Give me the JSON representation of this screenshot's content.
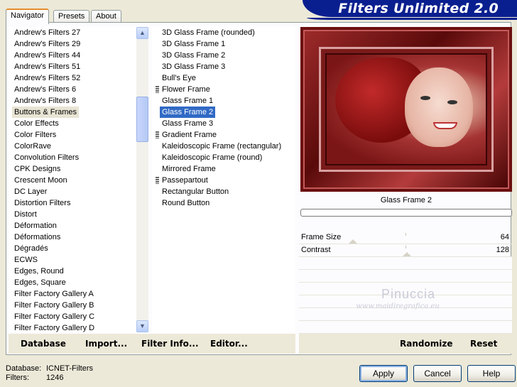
{
  "title": "Filters Unlimited 2.0",
  "tabs": [
    {
      "label": "Navigator",
      "active": true
    },
    {
      "label": "Presets",
      "active": false
    },
    {
      "label": "About",
      "active": false
    }
  ],
  "categories": {
    "selected": "Buttons & Frames",
    "items": [
      "Andrew's Filters 27",
      "Andrew's Filters 29",
      "Andrew's Filters 44",
      "Andrew's Filters 51",
      "Andrew's Filters 52",
      "Andrew's Filters 6",
      "Andrew's Filters 8",
      "Buttons & Frames",
      "Color Effects",
      "Color Filters",
      "ColorRave",
      "Convolution Filters",
      "CPK Designs",
      "Crescent Moon",
      "DC Layer",
      "Distortion Filters",
      "Distort",
      "Déformation",
      "Déformations",
      "Dégradés",
      "ECWS",
      "Edges, Round",
      "Edges, Square",
      "Filter Factory Gallery A",
      "Filter Factory Gallery B",
      "Filter Factory Gallery C",
      "Filter Factory Gallery D"
    ]
  },
  "filters": {
    "selected": "Glass Frame 2",
    "items": [
      {
        "label": "3D Glass Frame (rounded)",
        "group": false
      },
      {
        "label": "3D Glass Frame 1",
        "group": false
      },
      {
        "label": "3D Glass Frame 2",
        "group": false
      },
      {
        "label": "3D Glass Frame 3",
        "group": false
      },
      {
        "label": "Bull's Eye",
        "group": false
      },
      {
        "label": "Flower Frame",
        "group": true
      },
      {
        "label": "Glass Frame 1",
        "group": false
      },
      {
        "label": "Glass Frame 2",
        "group": false
      },
      {
        "label": "Glass Frame 3",
        "group": false
      },
      {
        "label": "Gradient Frame",
        "group": true
      },
      {
        "label": "Kaleidoscopic Frame (rectangular)",
        "group": false
      },
      {
        "label": "Kaleidoscopic Frame (round)",
        "group": false
      },
      {
        "label": "Mirrored Frame",
        "group": false
      },
      {
        "label": "Passepartout",
        "group": true
      },
      {
        "label": "Rectangular Button",
        "group": false
      },
      {
        "label": "Round Button",
        "group": false
      }
    ]
  },
  "preview": {
    "caption": "Glass Frame 2"
  },
  "sliders": [
    {
      "label": "Frame Size",
      "value": "64",
      "level": 64,
      "max": 255
    },
    {
      "label": "Contrast",
      "value": "128",
      "level": 128,
      "max": 255
    }
  ],
  "watermark": {
    "name": "Pinuccia",
    "site": "www.maidiregrafica.eu"
  },
  "toolbar": {
    "database": "Database",
    "import": "Import...",
    "filter_info": "Filter Info...",
    "editor": "Editor...",
    "randomize": "Randomize",
    "reset": "Reset"
  },
  "status": {
    "database_label": "Database:",
    "database_value": "ICNET-Filters",
    "filters_label": "Filters:",
    "filters_value": "1246"
  },
  "buttons": {
    "apply": "Apply",
    "cancel": "Cancel",
    "help": "Help"
  },
  "colors": {
    "banner": "#0a1f8f",
    "selection": "#316ac5",
    "tab_accent": "#e68b2c"
  }
}
